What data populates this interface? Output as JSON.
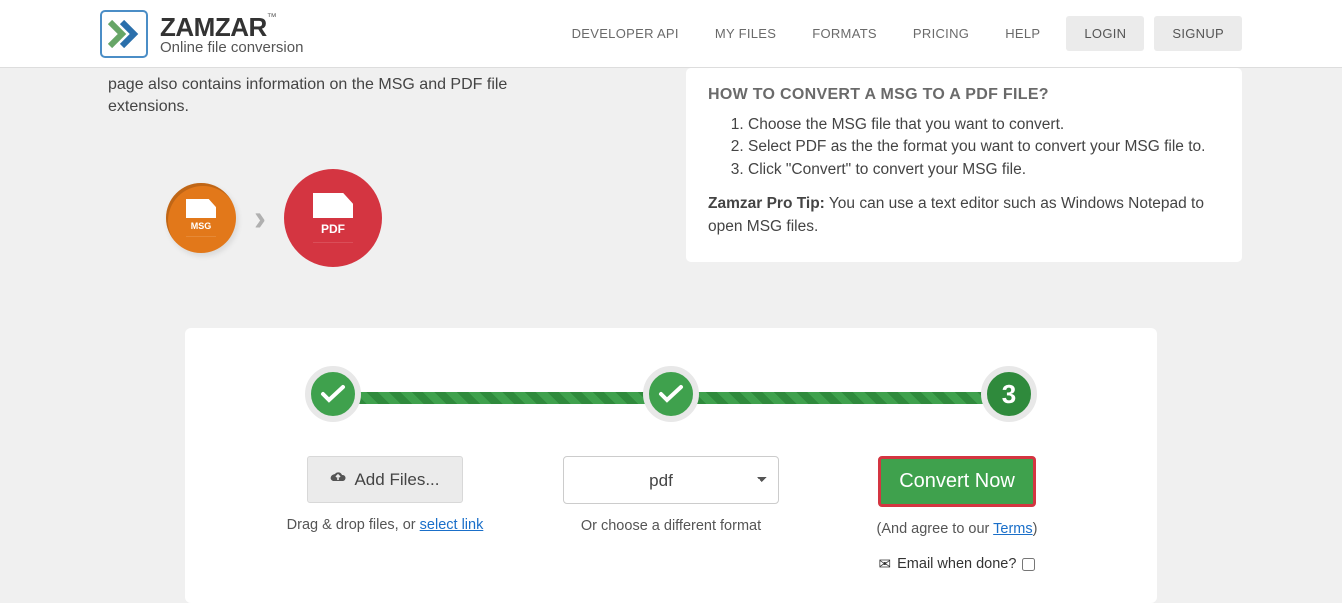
{
  "logo": {
    "title": "ZAMZAR",
    "tm": "™",
    "subtitle": "Online file conversion"
  },
  "nav": {
    "developer_api": "DEVELOPER API",
    "my_files": "MY FILES",
    "formats": "FORMATS",
    "pricing": "PRICING",
    "help": "HELP",
    "login": "LOGIN",
    "signup": "SIGNUP"
  },
  "intro_fragment": "page also contains information on the MSG and PDF file extensions.",
  "file_icons": {
    "from": "MSG",
    "to": "PDF"
  },
  "howto": {
    "title": "HOW TO CONVERT A MSG TO A PDF FILE?",
    "steps": [
      "Choose the MSG file that you want to convert.",
      "Select PDF as the the format you want to convert your MSG file to.",
      "Click \"Convert\" to convert your MSG file."
    ],
    "protip_label": "Zamzar Pro Tip:",
    "protip_text": " You can use a text editor such as Windows Notepad to open MSG files."
  },
  "converter": {
    "step3_number": "3",
    "add_files": "Add Files...",
    "drag_text": "Drag & drop files, or ",
    "select_link": "select link",
    "format_value": "pdf",
    "format_sub": "Or choose a different format",
    "convert": "Convert Now",
    "agree_pre": "(And agree to our ",
    "terms": "Terms",
    "agree_post": ")",
    "email_label": "Email when done?"
  }
}
